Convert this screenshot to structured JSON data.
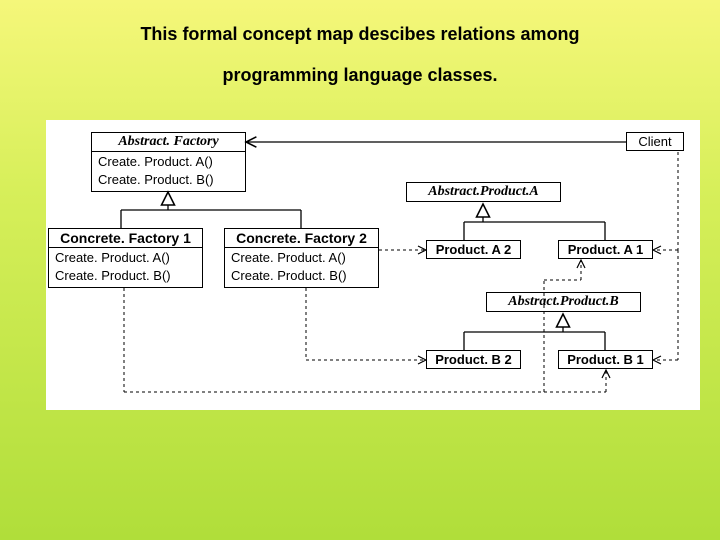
{
  "title_line1": "This formal concept map descibes relations among",
  "title_line2": "programming language classes.",
  "abstract_factory": {
    "name": "Abstract. Factory",
    "m1": "Create. Product. A()",
    "m2": "Create. Product. B()"
  },
  "client": "Client",
  "abstract_product_a": "Abstract.Product.A",
  "abstract_product_b": "Abstract.Product.B",
  "concrete_factory1": {
    "name": "Concrete. Factory 1",
    "m1": "Create. Product. A()",
    "m2": "Create. Product. B()"
  },
  "concrete_factory2": {
    "name": "Concrete. Factory 2",
    "m1": "Create. Product. A()",
    "m2": "Create. Product. B()"
  },
  "product_a2": "Product. A 2",
  "product_a1": "Product. A 1",
  "product_b2": "Product. B 2",
  "product_b1": "Product. B 1"
}
